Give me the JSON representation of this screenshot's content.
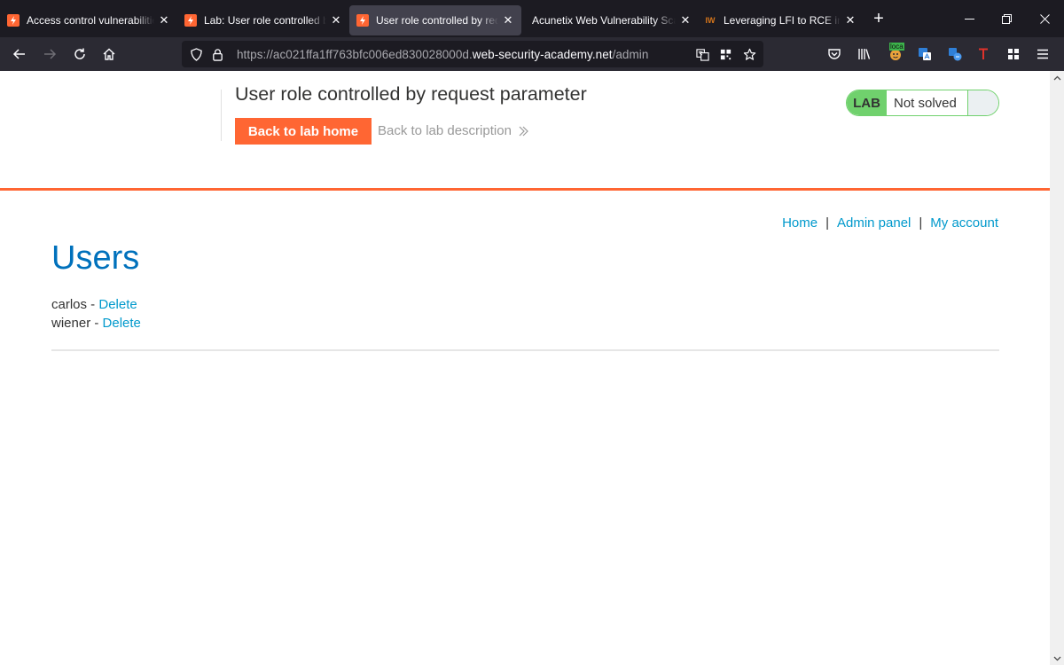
{
  "browser": {
    "tabs": [
      {
        "title": "Access control vulnerabilities",
        "favicon": "portswigger",
        "active": false
      },
      {
        "title": "Lab: User role controlled by request parameter",
        "favicon": "portswigger",
        "active": false
      },
      {
        "title": "User role controlled by request parameter",
        "favicon": "portswigger",
        "active": true
      },
      {
        "title": "Acunetix Web Vulnerability Scanner",
        "favicon": "none",
        "active": false
      },
      {
        "title": "Leveraging LFI to RCE in a website",
        "favicon": "iw",
        "active": false
      }
    ],
    "iw_favicon_text": "IW",
    "url": {
      "prefix": "https://ac021ffa1ff763bfc006ed830028000d.",
      "domain": "web-security-academy.net",
      "path": "/admin"
    },
    "extension_badge": "loca",
    "colors": {
      "tabbar": "#1c1b22",
      "navbar": "#2b2a33",
      "urlbar": "#1c1b22"
    }
  },
  "lab": {
    "title": "User role controlled by request parameter",
    "back_home_label": "Back to lab home",
    "back_description_label": "Back to lab description",
    "status_badge": "LAB",
    "status_text": "Not solved",
    "colors": {
      "accent": "#ff6633",
      "solved_green": "#70d16d"
    }
  },
  "nav": {
    "home": "Home",
    "separator": "|",
    "admin_panel": "Admin panel",
    "my_account": "My account"
  },
  "users": {
    "heading": "Users",
    "items": [
      {
        "name": "carlos",
        "separator": " - ",
        "action": "Delete"
      },
      {
        "name": "wiener",
        "separator": " - ",
        "action": "Delete"
      }
    ]
  }
}
